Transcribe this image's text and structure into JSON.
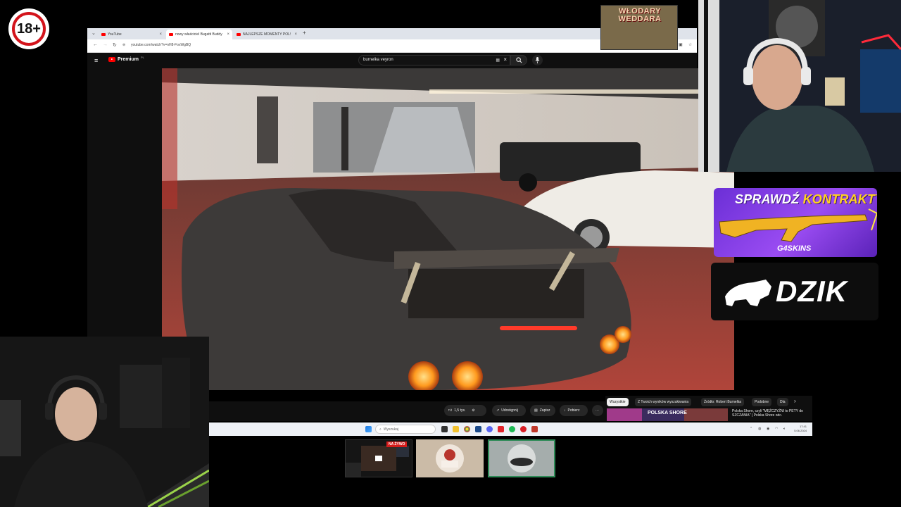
{
  "age_badge": "18+",
  "browser": {
    "tabs": [
      {
        "label": "YouTube",
        "active": false
      },
      {
        "label": "nowy właściciel Bugatti Buddy",
        "active": true
      },
      {
        "label": "NAJLEPSZE MOMENTY POLSKI",
        "active": false
      }
    ],
    "new_tab": "+",
    "url": "youtube.com/watch?v=nH8-FoxWgBQ"
  },
  "youtube": {
    "logo": "Premium",
    "logo_region": "PL",
    "search_query": "burnelka veyron"
  },
  "video_actions": {
    "likes": "1,5 tys.",
    "share": "Udostępnij",
    "save": "Zapisz",
    "download": "Pobierz"
  },
  "filter_chips": [
    "Wszystkie",
    "Z Twoich wyników wyszukiwania",
    "Źródło: Robert Burnelka",
    "Podobne",
    "Dla"
  ],
  "recommendation": {
    "title": "Polska Shore, czyli \"MĘŻCZYŹNI to PETY do SZCZANIA\" | Polska Shore odc.",
    "thumb_text": "POLSKA SHORE"
  },
  "taskbar": {
    "search_placeholder": "Wyszukaj",
    "time": "17:41",
    "date": "5.06.2024"
  },
  "scene_thumbs": {
    "live_label": "NA ŻYWO"
  },
  "overlay_title": [
    "WŁODARY",
    "WEDDARA"
  ],
  "banners": {
    "g4_headline_white": "SPRAWDŹ ",
    "g4_headline_yellow": "KONTRAKTY!",
    "g4_brand": "G4SKINS",
    "dzik": "DZIK"
  },
  "colors": {
    "youtube_red": "#ff0000",
    "age_ring": "#d3131b",
    "g4_yellow": "#ffd21f",
    "live_red": "#d31b1b"
  }
}
